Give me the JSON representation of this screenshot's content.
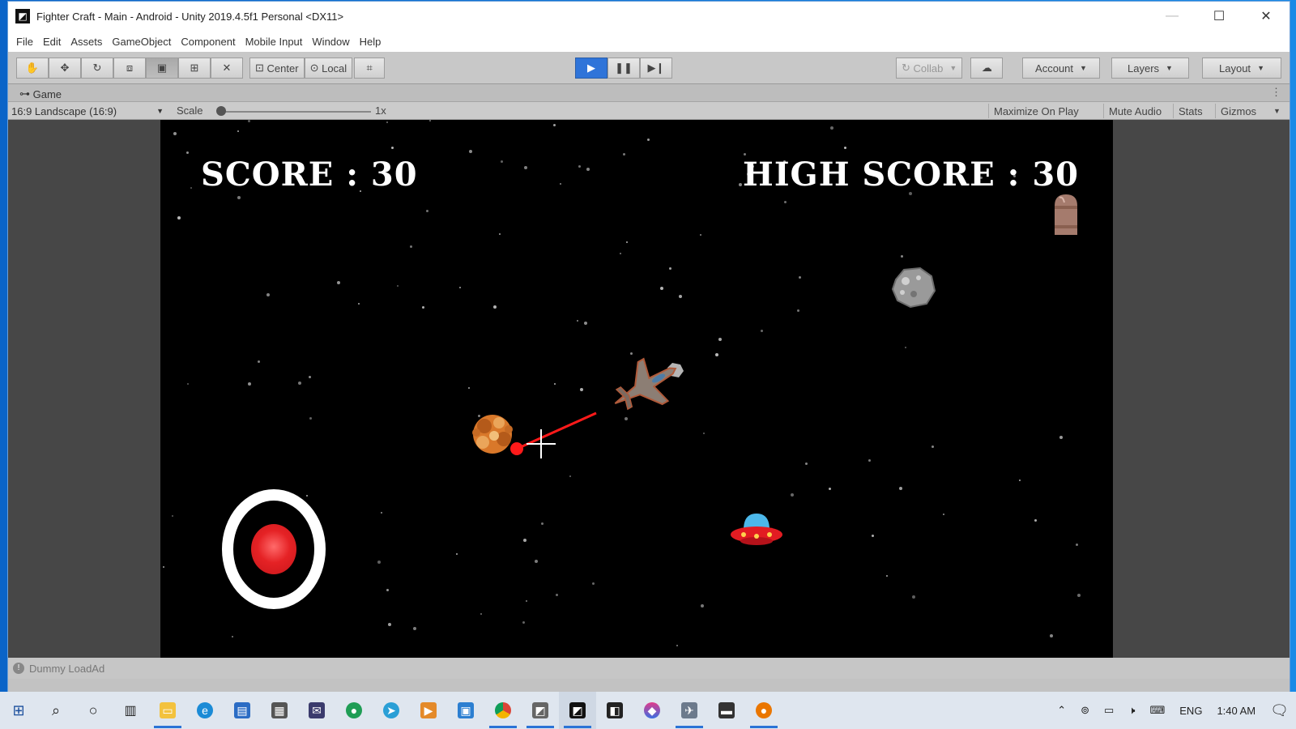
{
  "window": {
    "title": "Fighter Craft - Main - Android - Unity 2019.4.5f1 Personal <DX11>",
    "controls": {
      "minimize": "—",
      "maximize": "☐",
      "close": "✕"
    }
  },
  "menu": [
    "File",
    "Edit",
    "Assets",
    "GameObject",
    "Component",
    "Mobile Input",
    "Window",
    "Help"
  ],
  "toolbar": {
    "tools": [
      "hand-tool-icon",
      "move-tool-icon",
      "rotate-tool-icon",
      "scale-tool-icon",
      "rect-tool-icon",
      "transform-tool-icon",
      "custom-tool-icon"
    ],
    "pivot": "Center",
    "space": "Local",
    "collab": "Collab",
    "account": "Account",
    "layers": "Layers",
    "layout": "Layout",
    "play_state": "playing"
  },
  "game_tab": {
    "label": "Game"
  },
  "game_controls": {
    "aspect": "16:9 Landscape (16:9)",
    "scale_label": "Scale",
    "scale_value": "1x",
    "scale_fraction": 0.0,
    "maximize": "Maximize On Play",
    "mute": "Mute Audio",
    "stats": "Stats",
    "gizmos": "Gizmos"
  },
  "game": {
    "score_text": "SCORE : 30",
    "high_score_text": "HIGH SCORE : 30",
    "colors": {
      "laser": "#ff1a1a",
      "fire_button": "#e52225",
      "explosion": "#d9782a"
    }
  },
  "status": {
    "text": "Dummy LoadAd"
  },
  "taskbar": {
    "apps": [
      "start-icon",
      "search-icon",
      "cortana-icon",
      "task-view-icon",
      "file-explorer-icon",
      "edge-icon",
      "app-icon-1",
      "store-icon",
      "app-icon-2",
      "app-icon-3",
      "app-icon-4",
      "app-icon-5",
      "app-icon-6",
      "chrome-icon",
      "visual-studio-icon",
      "unity-icon",
      "unity-hub-icon",
      "app-icon-7",
      "app-icon-8",
      "app-icon-9",
      "blender-icon"
    ],
    "tray": {
      "language": "ENG",
      "time": "1:40 AM"
    }
  }
}
